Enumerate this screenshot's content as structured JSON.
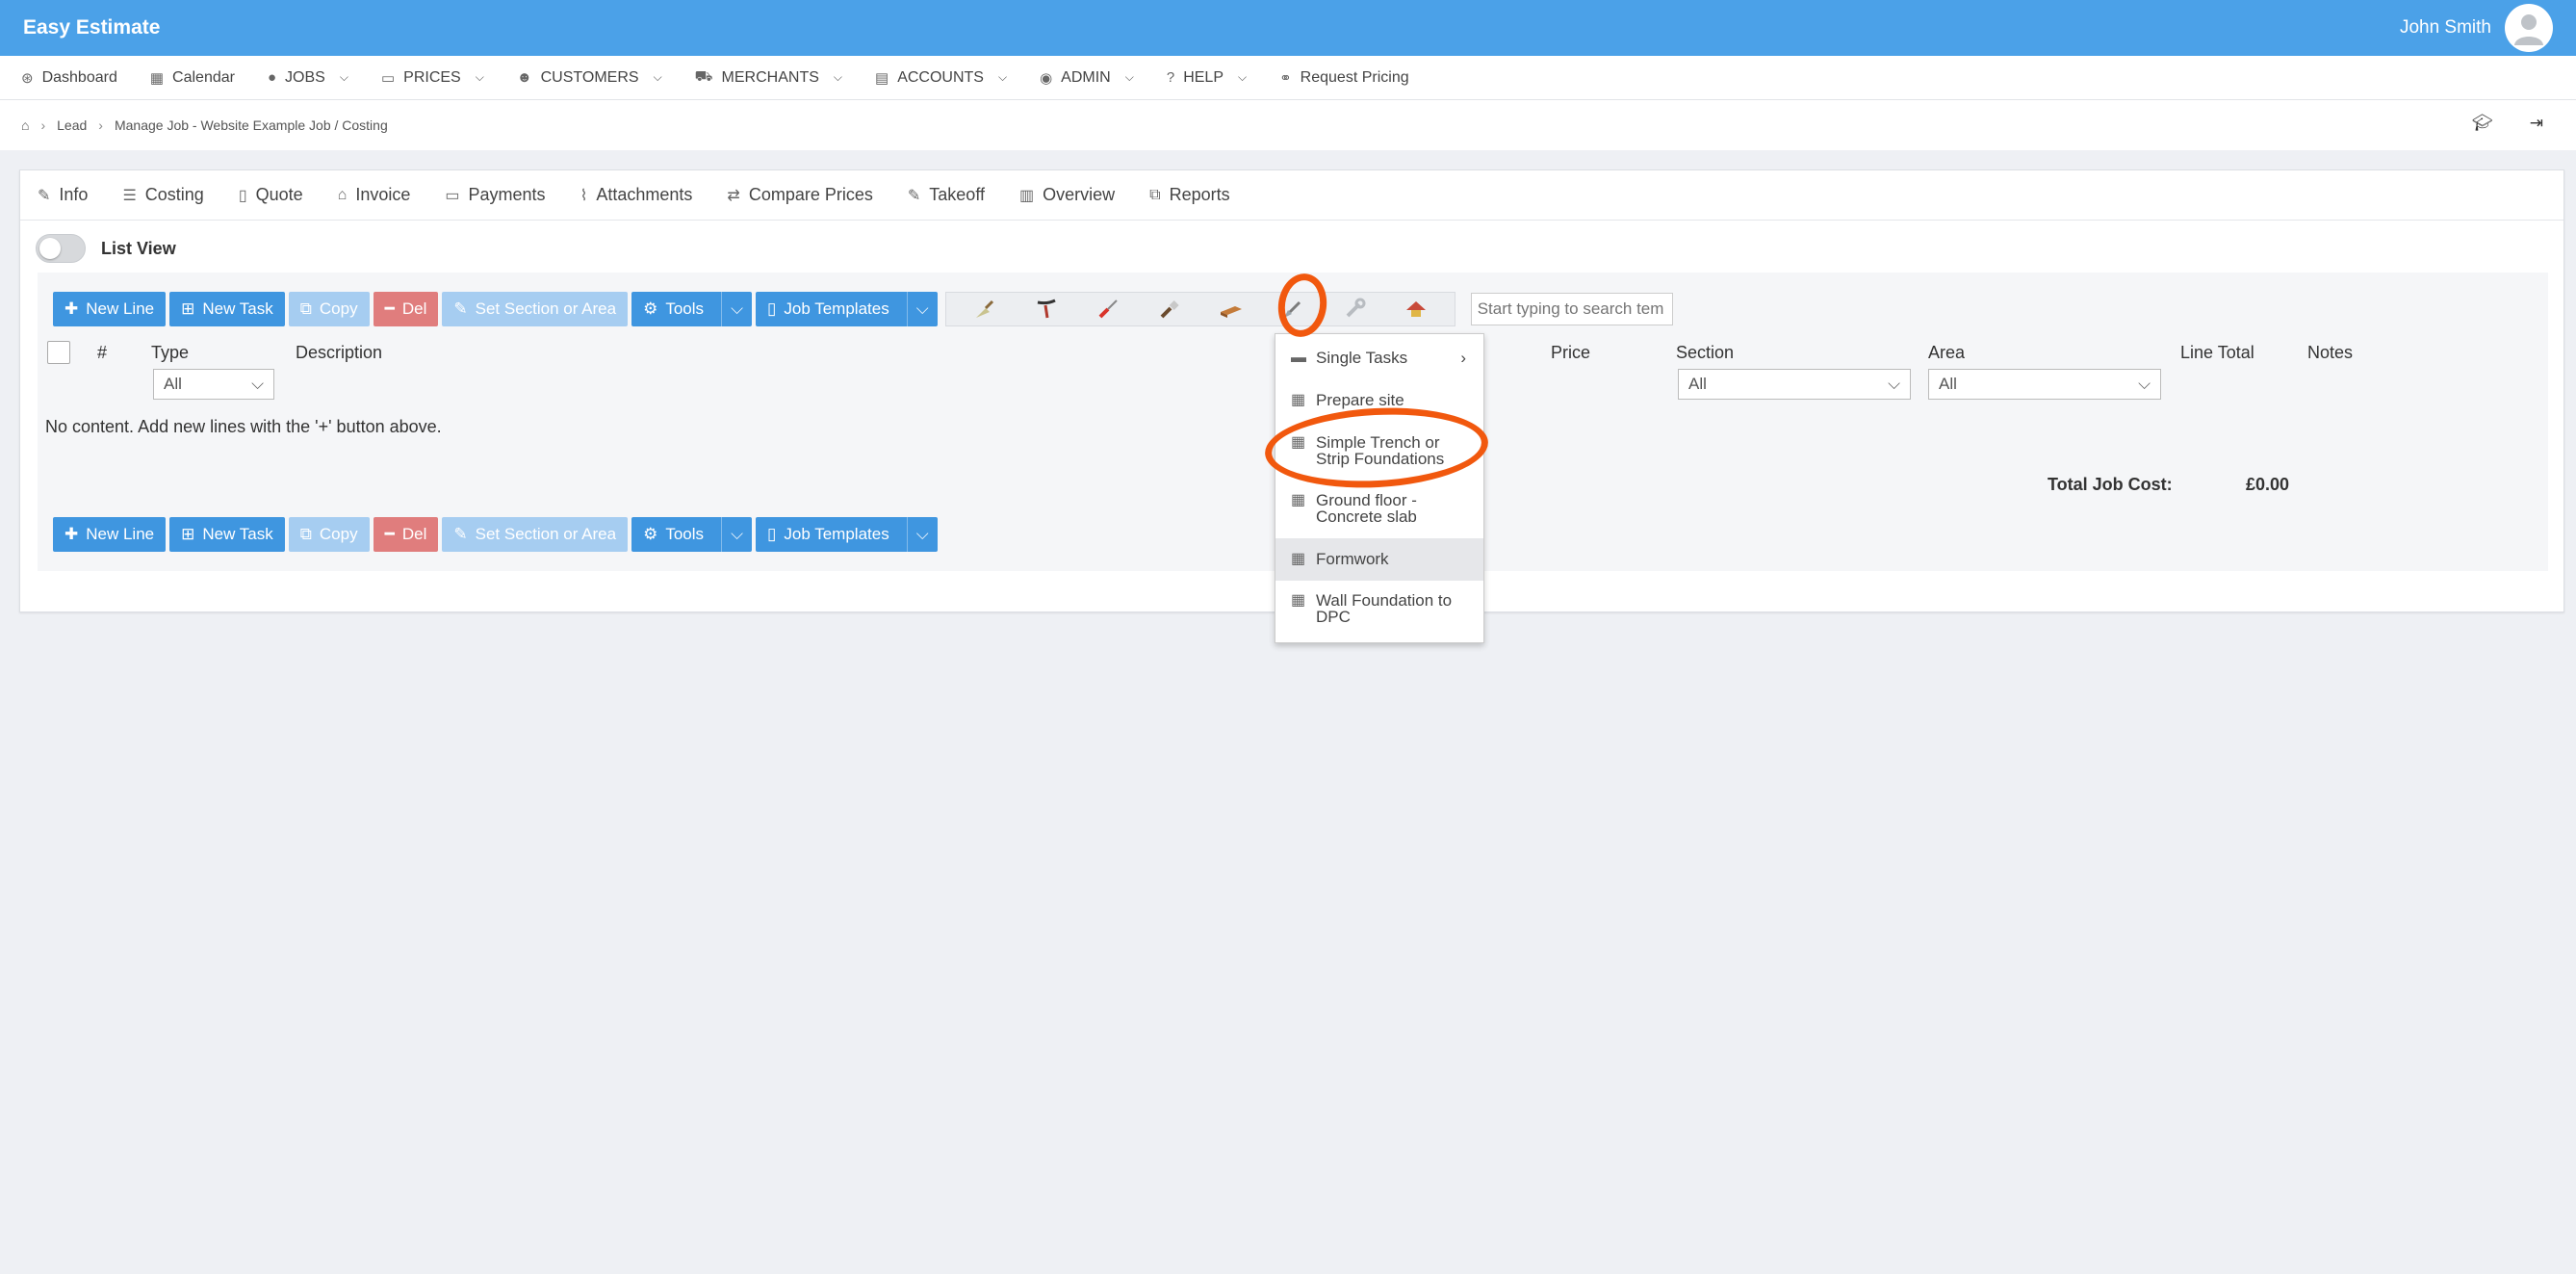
{
  "app": {
    "title": "Easy Estimate",
    "user_name": "John Smith"
  },
  "nav": [
    {
      "label": "Dashboard",
      "icon": "dashboard-icon",
      "glyph": "⊛",
      "dropdown": false
    },
    {
      "label": "Calendar",
      "icon": "calendar-icon",
      "glyph": "▦",
      "dropdown": false
    },
    {
      "label": "JOBS",
      "icon": "globe-icon",
      "glyph": "●",
      "dropdown": true
    },
    {
      "label": "PRICES",
      "icon": "money-icon",
      "glyph": "▭",
      "dropdown": true
    },
    {
      "label": "CUSTOMERS",
      "icon": "users-icon",
      "glyph": "☻",
      "dropdown": true
    },
    {
      "label": "MERCHANTS",
      "icon": "cart-icon",
      "glyph": "⛟",
      "dropdown": true
    },
    {
      "label": "ACCOUNTS",
      "icon": "accounts-icon",
      "glyph": "▤",
      "dropdown": true
    },
    {
      "label": "ADMIN",
      "icon": "user-circle-icon",
      "glyph": "◉",
      "dropdown": true
    },
    {
      "label": "HELP",
      "icon": "question-icon",
      "glyph": "?",
      "dropdown": true
    },
    {
      "label": "Request Pricing",
      "icon": "handshake-icon",
      "glyph": "⚭",
      "dropdown": false
    }
  ],
  "breadcrumb": {
    "items": [
      "Lead",
      "Manage Job - Website Example Job / Costing"
    ]
  },
  "tabs": [
    {
      "label": "Info",
      "icon": "edit-icon",
      "glyph": "✎"
    },
    {
      "label": "Costing",
      "icon": "list-icon",
      "glyph": "☰"
    },
    {
      "label": "Quote",
      "icon": "file-icon",
      "glyph": "▯"
    },
    {
      "label": "Invoice",
      "icon": "bank-icon",
      "glyph": "⌂"
    },
    {
      "label": "Payments",
      "icon": "money-icon",
      "glyph": "▭"
    },
    {
      "label": "Attachments",
      "icon": "paperclip-icon",
      "glyph": "⌇"
    },
    {
      "label": "Compare Prices",
      "icon": "exchange-icon",
      "glyph": "⇄"
    },
    {
      "label": "Takeoff",
      "icon": "edit-icon",
      "glyph": "✎"
    },
    {
      "label": "Overview",
      "icon": "bar-chart-icon",
      "glyph": "▥"
    },
    {
      "label": "Reports",
      "icon": "copy-icon",
      "glyph": "⧉"
    }
  ],
  "list_view_label": "List View",
  "toolbar": {
    "new_line": "New Line",
    "new_task": "New Task",
    "copy": "Copy",
    "del": "Del",
    "set_section": "Set Section or Area",
    "tools": "Tools",
    "job_templates": "Job Templates",
    "search_placeholder": "Start typing to search tem"
  },
  "trade_tools": [
    {
      "name": "trowel-tool-icon"
    },
    {
      "name": "pliers-tool-icon"
    },
    {
      "name": "screwdriver-tool-icon"
    },
    {
      "name": "brush-tool-icon"
    },
    {
      "name": "brick-tool-icon"
    },
    {
      "name": "spade-tool-icon"
    },
    {
      "name": "wrench-tool-icon"
    },
    {
      "name": "roof-tool-icon"
    }
  ],
  "table": {
    "headers": {
      "num": "#",
      "type": "Type",
      "description": "Description",
      "price": "Price",
      "section": "Section",
      "area": "Area",
      "line_total": "Line Total",
      "notes": "Notes"
    },
    "type_filter": "All",
    "section_filter": "All",
    "area_filter": "All",
    "empty_message": "No content. Add new lines with the '+' button above.",
    "total_label": "Total Job Cost:",
    "total_value": "£0.00"
  },
  "dropdown_menu": {
    "items": [
      {
        "label": "Single Tasks",
        "kind": "folder"
      },
      {
        "label": "Prepare site",
        "kind": "calc"
      },
      {
        "label": "Simple Trench or Strip Foundations",
        "kind": "calc"
      },
      {
        "label": "Ground floor - Concrete slab",
        "kind": "calc"
      },
      {
        "label": "Formwork",
        "kind": "calc"
      },
      {
        "label": "Wall Foundation to DPC",
        "kind": "calc"
      }
    ]
  },
  "colors": {
    "brand": "#4ba1e8",
    "button_blue": "#3f96e0",
    "button_light": "#a6cdf1",
    "button_red": "#e07d7d",
    "annotation": "#f1580e"
  }
}
